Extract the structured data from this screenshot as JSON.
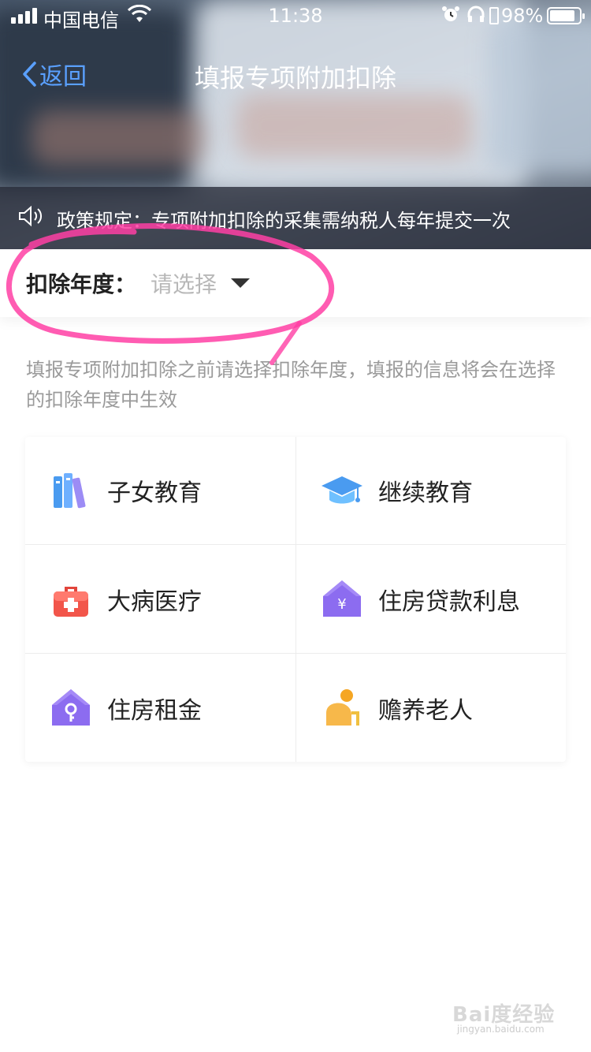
{
  "status_bar": {
    "carrier": "中国电信",
    "time": "11:38",
    "battery_percent": "98%",
    "battery_level": 0.98,
    "icons": [
      "signal-icon",
      "wifi-icon",
      "alarm-icon",
      "headphones-icon",
      "battery-icon"
    ]
  },
  "nav": {
    "back_label": "返回",
    "title": "填报专项附加扣除"
  },
  "notice": {
    "text": "政策规定：专项附加扣除的采集需纳税人每年提交一次"
  },
  "deduction_year": {
    "label": "扣除年度：",
    "placeholder": "请选择"
  },
  "hint": "填报专项附加扣除之前请选择扣除年度，填报的信息将会在选择的扣除年度中生效",
  "categories": [
    {
      "label": "子女教育",
      "icon": "books-icon"
    },
    {
      "label": "继续教育",
      "icon": "graduation-cap-icon"
    },
    {
      "label": "大病医疗",
      "icon": "medical-kit-icon"
    },
    {
      "label": "住房贷款利息",
      "icon": "house-yuan-icon"
    },
    {
      "label": "住房租金",
      "icon": "house-key-icon"
    },
    {
      "label": "赡养老人",
      "icon": "elderly-person-icon"
    }
  ],
  "watermark": {
    "brand": "Bai度经验",
    "url": "jingyan.baidu.com"
  },
  "colors": {
    "accent_blue": "#5aa0ff",
    "annotation_pink": "#ff3fa4",
    "icon_red": "#f2554a",
    "icon_purple": "#8c6cf0",
    "icon_orange": "#f5a623"
  }
}
